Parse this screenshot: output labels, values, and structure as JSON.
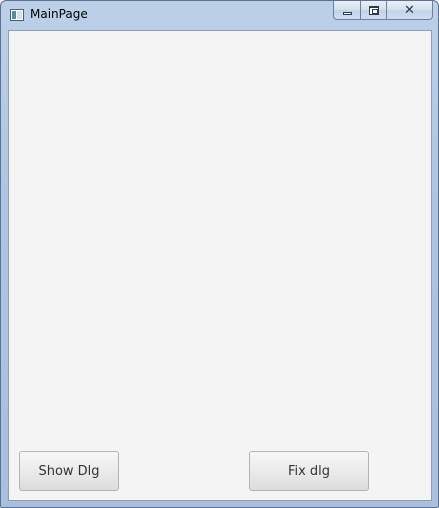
{
  "window": {
    "title": "MainPage",
    "icon": "app-window-icon",
    "caption": {
      "minimize_icon": "minimize-icon",
      "maximize_icon": "restore-icon",
      "close_glyph": "✕"
    }
  },
  "content": {
    "buttons": {
      "show_dlg_label": "Show Dlg",
      "fix_dlg_label": "Fix dlg"
    }
  },
  "colors": {
    "client_background": "#f4f4f4",
    "frame": "#aec4e0",
    "button_text": "#333333"
  }
}
